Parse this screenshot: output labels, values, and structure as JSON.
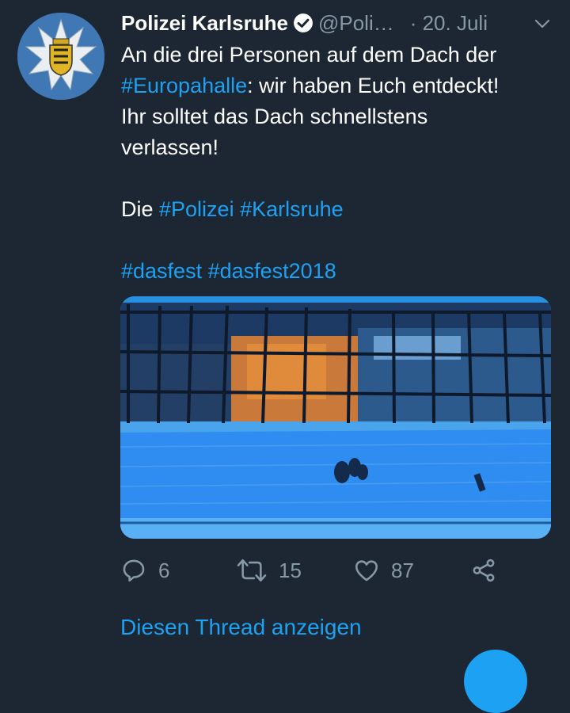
{
  "tweet": {
    "author_name": "Polizei Karlsruhe",
    "handle": "@Poli…",
    "time": "· 20. Juli",
    "body": {
      "line1": "An die drei Personen auf dem Dach der",
      "line2_hashtag": "#Europahalle",
      "line2_rest": ": wir haben Euch entdeckt!",
      "line3": "Ihr solltet das Dach schnellstens",
      "line4": "verlassen!",
      "line5_prefix": "Die ",
      "line5_tag1": "#Polizei",
      "line5_sep": " ",
      "line5_tag2": "#Karlsruhe",
      "line6_tag1": "#dasfest",
      "line6_sep": " ",
      "line6_tag2": "#dasfest2018"
    },
    "actions": {
      "reply_count": "6",
      "retweet_count": "15",
      "like_count": "87"
    },
    "thread_link": "Diesen Thread anzeigen"
  },
  "colors": {
    "background": "#1c2733",
    "accent": "#1da1f2",
    "muted": "#8899a6"
  },
  "icons": {
    "verified": "verified-badge-icon",
    "menu": "chevron-down-icon",
    "reply": "reply-icon",
    "retweet": "retweet-icon",
    "like": "heart-icon",
    "share": "share-icon"
  }
}
